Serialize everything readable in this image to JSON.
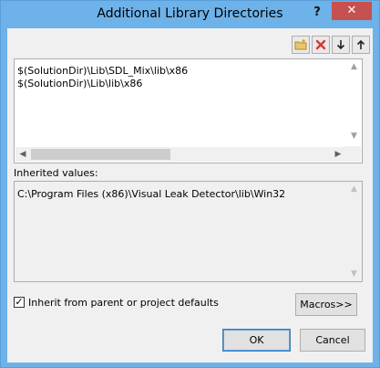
{
  "window": {
    "title": "Additional Library Directories",
    "help_label": "?",
    "close_label": "✕"
  },
  "toolbar": {
    "new_line_icon": "new-folder-icon",
    "delete_icon": "delete-icon",
    "move_down_icon": "arrow-down-icon",
    "move_up_icon": "arrow-up-icon"
  },
  "directories": [
    "$(SolutionDir)\\Lib\\SDL_Mix\\lib\\x86",
    "$(SolutionDir)\\Lib\\lib\\x86"
  ],
  "inherited": {
    "label": "Inherited values:",
    "values": [
      "C:\\Program Files (x86)\\Visual Leak Detector\\lib\\Win32"
    ]
  },
  "options": {
    "inherit_label": "Inherit from parent or project defaults",
    "inherit_checked": true
  },
  "buttons": {
    "macros": "Macros>>",
    "ok": "OK",
    "cancel": "Cancel"
  },
  "colors": {
    "title_bar": "#6eb2ea",
    "close_button": "#c75050",
    "delete_icon": "#d83a2e",
    "arrow_icon": "#222222"
  }
}
